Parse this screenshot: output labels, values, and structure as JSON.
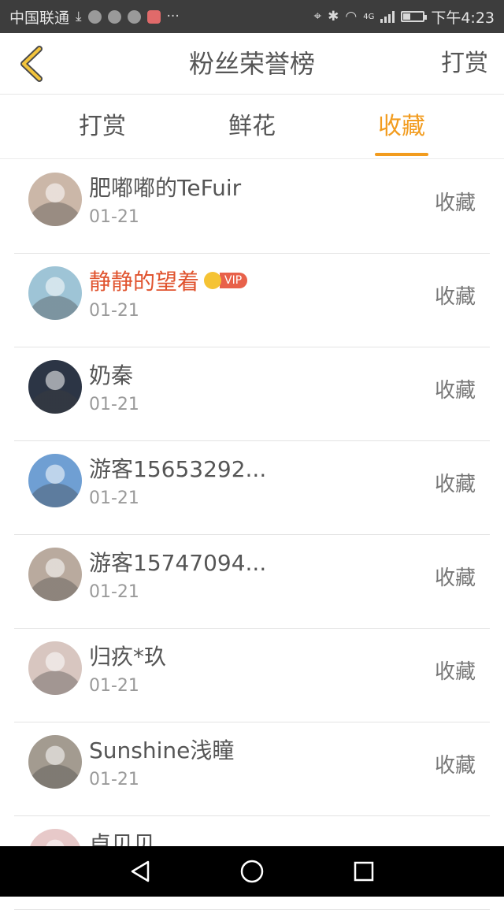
{
  "status_bar": {
    "carrier": "中国联通",
    "network": "4G",
    "battery_level": 0.35,
    "time": "下午4:23"
  },
  "header": {
    "title": "粉丝荣誉榜",
    "action_label": "打赏",
    "accent_color": "#f29c1f"
  },
  "tabs": [
    {
      "label": "打赏",
      "active": false
    },
    {
      "label": "鲜花",
      "active": false
    },
    {
      "label": "收藏",
      "active": true
    }
  ],
  "rows": [
    {
      "name": "肥嘟嘟的TeFuir",
      "date": "01-21",
      "action": "收藏",
      "vip": false,
      "avatar_color": "#cbb7a8"
    },
    {
      "name": "静静的望着",
      "date": "01-21",
      "action": "收藏",
      "vip": true,
      "vip_label": "VIP",
      "avatar_color": "#9ec4d6"
    },
    {
      "name": "奶秦",
      "date": "01-21",
      "action": "收藏",
      "vip": false,
      "avatar_color": "#2c3545"
    },
    {
      "name": "游客15653292...",
      "date": "01-21",
      "action": "收藏",
      "vip": false,
      "avatar_color": "#6f9fd3"
    },
    {
      "name": "游客15747094...",
      "date": "01-21",
      "action": "收藏",
      "vip": false,
      "avatar_color": "#b9aa9e"
    },
    {
      "name": "归疚*玖",
      "date": "01-21",
      "action": "收藏",
      "vip": false,
      "avatar_color": "#d8c6c0"
    },
    {
      "name": "Sunshine浅瞳",
      "date": "01-21",
      "action": "收藏",
      "vip": false,
      "avatar_color": "#a39b90"
    },
    {
      "name": "卓贝贝",
      "date": "",
      "action": "",
      "vip": false,
      "avatar_color": "#e7c9c9"
    }
  ]
}
